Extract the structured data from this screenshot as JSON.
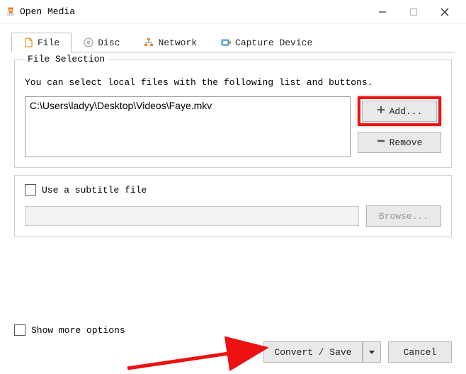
{
  "window": {
    "title": "Open Media"
  },
  "tabs": {
    "file": "File",
    "disc": "Disc",
    "network": "Network",
    "capture": "Capture Device"
  },
  "file_selection": {
    "legend": "File Selection",
    "help": "You can select local files with the following list and buttons.",
    "files": [
      "C:\\Users\\ladyy\\Desktop\\Videos\\Faye.mkv"
    ],
    "add_label": "Add...",
    "remove_label": "Remove"
  },
  "subtitle": {
    "checkbox_label": "Use a subtitle file",
    "browse_label": "Browse..."
  },
  "footer": {
    "show_more": "Show more options",
    "convert_save": "Convert / Save",
    "cancel": "Cancel"
  }
}
